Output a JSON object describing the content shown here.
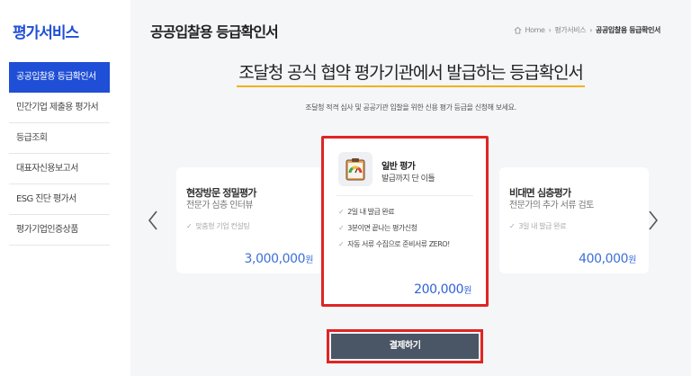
{
  "sidebar": {
    "title": "평가서비스",
    "items": [
      {
        "label": "공공입찰용 등급확인서",
        "active": true
      },
      {
        "label": "민간기업 제출용 평가서",
        "active": false
      },
      {
        "label": "등급조회",
        "active": false
      },
      {
        "label": "대표자신용보고서",
        "active": false
      },
      {
        "label": "ESG 진단 평가서",
        "active": false
      },
      {
        "label": "평가기업인증상품",
        "active": false
      }
    ]
  },
  "header": {
    "title": "공공입찰용 등급확인서",
    "breadcrumb": [
      "Home",
      "평가서비스",
      "공공입찰용 등급확인서"
    ]
  },
  "main": {
    "headline": "조달청 공식 협약 평가기관에서 발급하는 등급확인서",
    "subline": "조달청 적격 심사 및 공공기관 입찰을 위한 신용 평가 등급을 신청해 보세요."
  },
  "cards": {
    "left": {
      "title": "현장방문 정밀평가",
      "desc": "전문가 심층 인터뷰",
      "feature": "맞춤형 기업 컨설팅",
      "price": "3,000,000",
      "unit": "원"
    },
    "center": {
      "title": "일반 평가",
      "desc": "발급까지 단 이틀",
      "features": [
        "2일 내 발급 완료",
        "3분이면 끝나는 평가신청",
        "자동 서류 수집으로 준비서류 ZERO!"
      ],
      "price": "200,000",
      "unit": "원",
      "icon": "gauge-clipboard-icon"
    },
    "right": {
      "title": "비대면 심층평가",
      "desc": "전문가의 추가 서류 검토",
      "feature": "3일 내 발급 완료",
      "price": "400,000",
      "unit": "원"
    }
  },
  "actions": {
    "pay_label": "결제하기"
  },
  "colors": {
    "brand": "#1f4fd6",
    "highlight_border": "#e02424",
    "underline": "#f2b21c",
    "price": "#3d6fd8",
    "button": "#4a5565"
  }
}
